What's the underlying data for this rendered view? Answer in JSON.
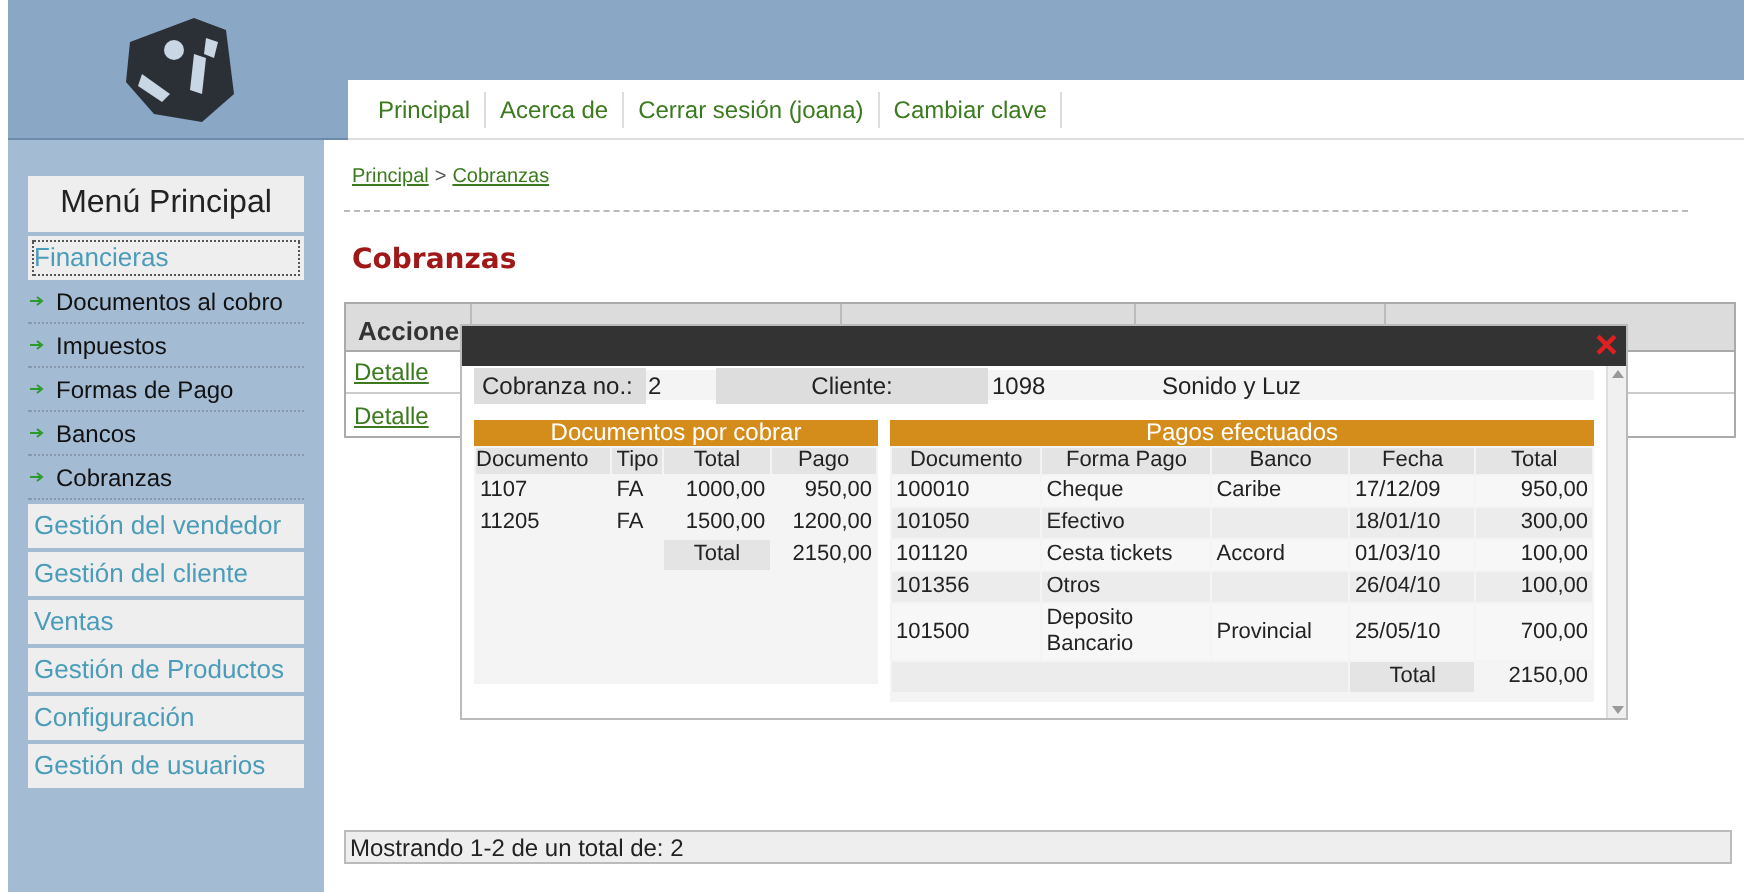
{
  "nav": [
    {
      "label": "Principal"
    },
    {
      "label": "Acerca de"
    },
    {
      "label": "Cerrar sesión (joana)"
    },
    {
      "label": "Cambiar clave"
    }
  ],
  "sidebar": {
    "title": "Menú Principal",
    "items": [
      {
        "label": "Financieras",
        "selected": true,
        "children": [
          {
            "label": "Documentos al cobro"
          },
          {
            "label": "Impuestos"
          },
          {
            "label": "Formas de Pago"
          },
          {
            "label": "Bancos"
          },
          {
            "label": "Cobranzas"
          }
        ]
      },
      {
        "label": "Gestión del vendedor",
        "selected": false
      },
      {
        "label": "Gestión del cliente",
        "selected": false
      },
      {
        "label": "Ventas",
        "selected": false
      },
      {
        "label": "Gestión de Productos",
        "selected": false
      },
      {
        "label": "Configuración",
        "selected": false
      },
      {
        "label": "Gestión de usuarios",
        "selected": false
      }
    ]
  },
  "breadcrumb": [
    "Principal",
    "Cobranzas"
  ],
  "breadcrumb_separator": ">",
  "page_title": "Cobranzas",
  "table": {
    "columns": [
      "Accione"
    ],
    "rows": [
      {
        "action": "Detalle"
      },
      {
        "action": "Detalle"
      }
    ]
  },
  "dialog": {
    "close": "×",
    "cobranza_label": "Cobranza no.:",
    "cobranza_value": "2",
    "cliente_label": "Cliente:",
    "cliente_code": "1098",
    "cliente_name": "Sonido y Luz",
    "documents": {
      "title": "Documentos por cobrar",
      "columns": [
        "Documento",
        "Tipo",
        "Total",
        "Pago"
      ],
      "rows": [
        [
          "1107",
          "FA",
          "1000,00",
          "950,00"
        ],
        [
          "11205",
          "FA",
          "1500,00",
          "1200,00"
        ]
      ],
      "total_label": "Total",
      "total": "2150,00"
    },
    "payments": {
      "title": "Pagos efectuados",
      "columns": [
        "Documento",
        "Forma Pago",
        "Banco",
        "Fecha",
        "Total"
      ],
      "rows": [
        [
          "100010",
          "Cheque",
          "Caribe",
          "17/12/09",
          "950,00"
        ],
        [
          "101050",
          "Efectivo",
          "",
          "18/01/10",
          "300,00"
        ],
        [
          "101120",
          "Cesta tickets",
          "Accord",
          "01/03/10",
          "100,00"
        ],
        [
          "101356",
          "Otros",
          "",
          "26/04/10",
          "100,00"
        ],
        [
          "101500",
          "Deposito Bancario",
          "Provincial",
          "25/05/10",
          "700,00"
        ]
      ],
      "total_label": "Total",
      "total": "2150,00"
    }
  },
  "footer": "Mostrando 1-2 de un total de: 2"
}
